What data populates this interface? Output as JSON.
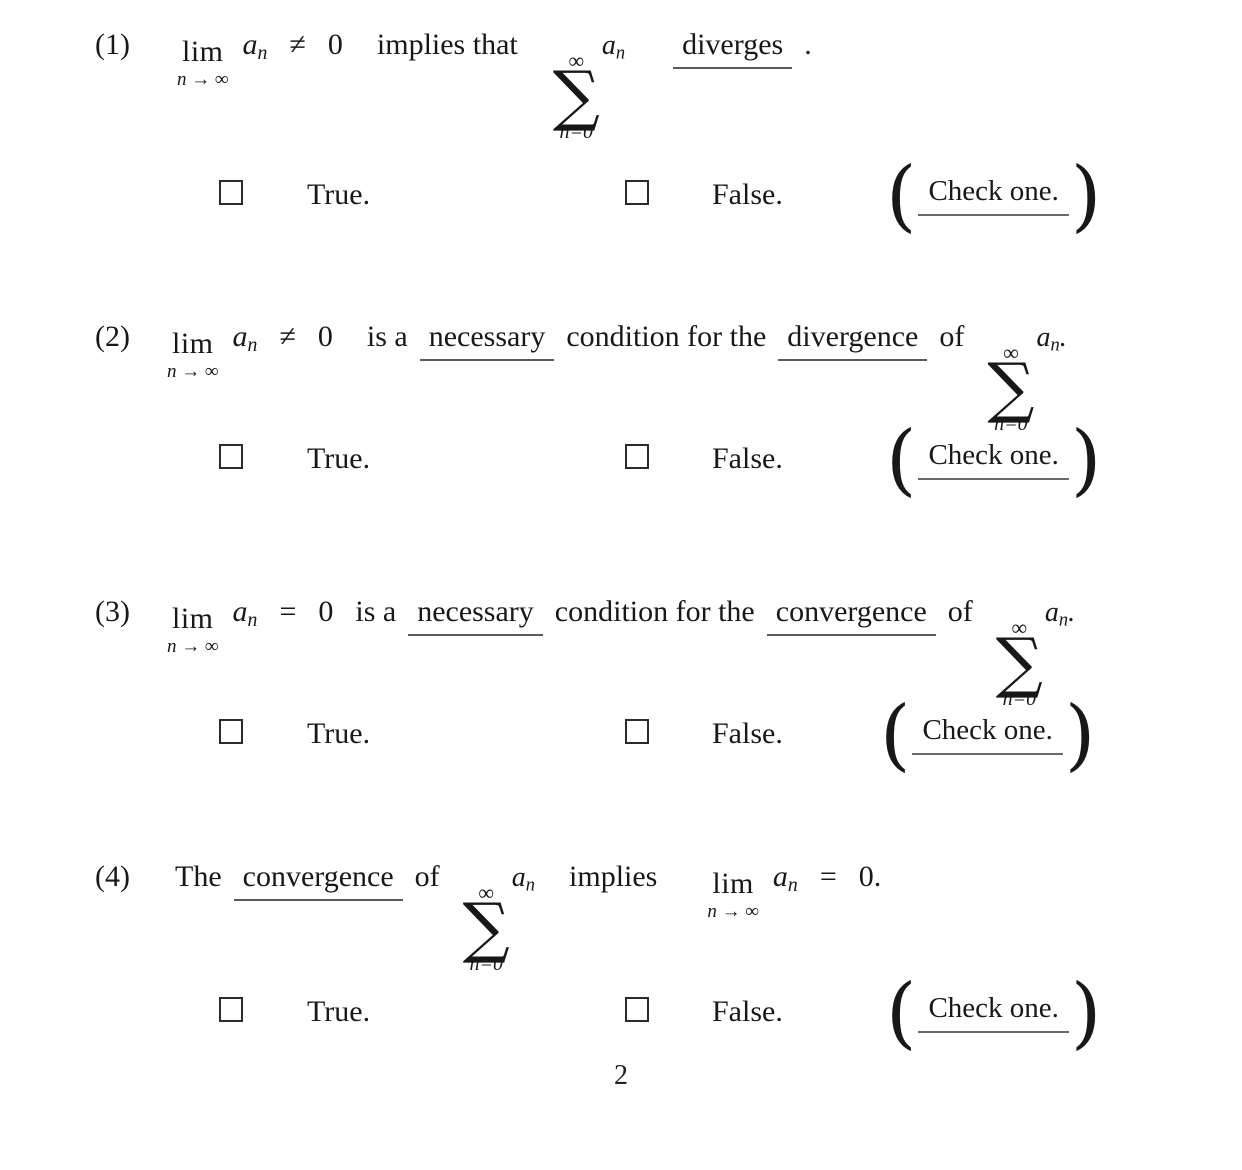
{
  "document": {
    "type": "math-worksheet",
    "page_number": "2",
    "background_color": "#ffffff",
    "text_color": "#181818",
    "rule_color": "#5a5a5a"
  },
  "answer_row": {
    "true_label": "True.",
    "false_label": "False.",
    "check_one_label": "Check one.",
    "left_paren": "(",
    "right_paren": ")",
    "checkbox_state": "unchecked"
  },
  "symbols": {
    "lim": "lim",
    "n_to_infinity": "n → ∞",
    "sum_glyph": "∑",
    "infinity": "∞",
    "n_equals_0": "n=0",
    "a_n": "a",
    "subscript_n": "n",
    "not_equal": "≠",
    "equal": "=",
    "zero": "0",
    "zero_period": "0.",
    "period": ".",
    "a_n_period": "."
  },
  "questions": [
    {
      "number": "(1)",
      "statement_parts": {
        "relation": "≠",
        "rhs": "0",
        "connective": "implies that",
        "blank_word": "diverges",
        "trailing": "."
      }
    },
    {
      "number": "(2)",
      "statement_parts": {
        "relation": "≠",
        "rhs": "0",
        "lead": "is a",
        "blank_word_1": "necessary",
        "middle": "condition for the",
        "blank_word_2": "divergence",
        "tail": "of"
      }
    },
    {
      "number": "(3)",
      "statement_parts": {
        "relation": "=",
        "rhs": "0",
        "lead": "is a",
        "blank_word_1": "necessary",
        "middle": "condition for the",
        "blank_word_2": "convergence",
        "tail": "of"
      }
    },
    {
      "number": "(4)",
      "statement_parts": {
        "lead": "The",
        "blank_word": "convergence",
        "tail": "of",
        "connective": "implies",
        "relation": "=",
        "rhs": "0."
      }
    }
  ]
}
